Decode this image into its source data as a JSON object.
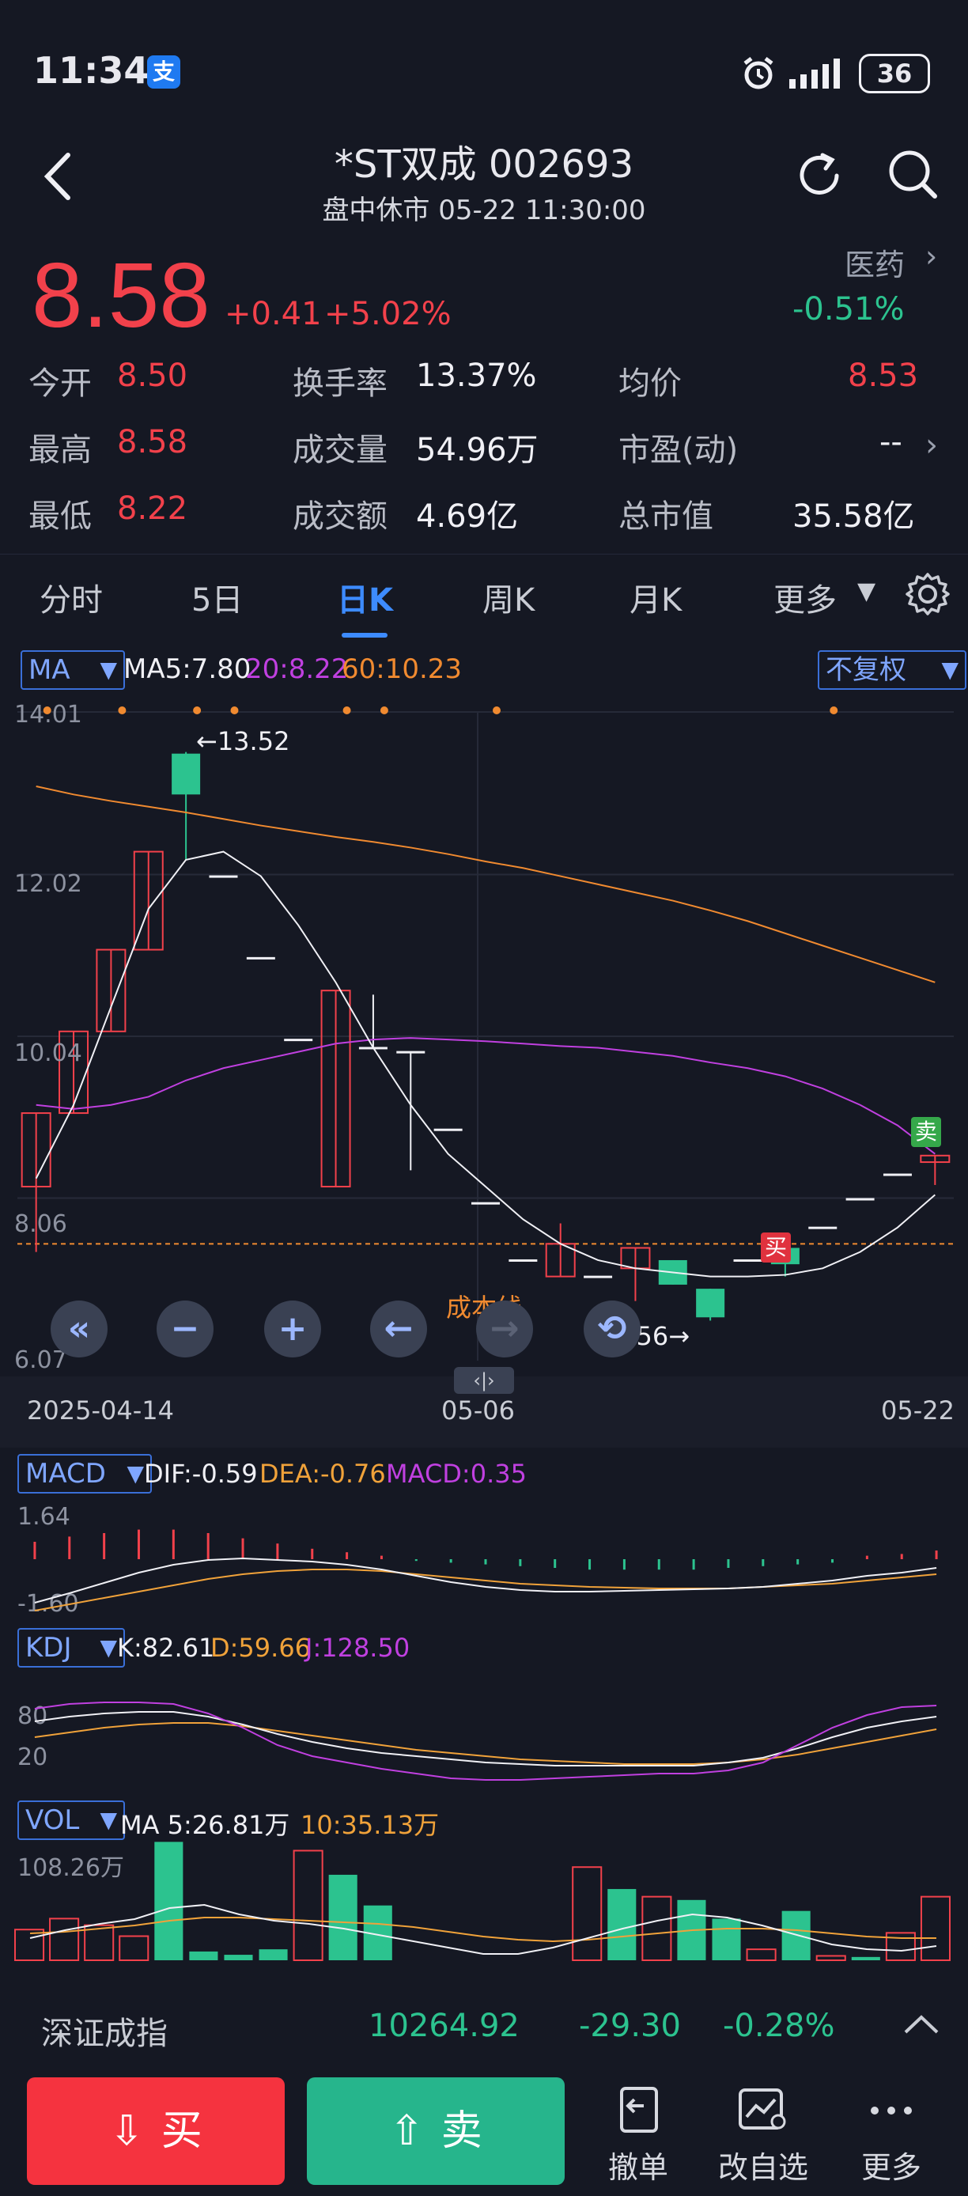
{
  "status_bar": {
    "time": "11:34",
    "app_badge": "支",
    "battery": "36"
  },
  "header": {
    "title": "*ST双成 002693",
    "subtitle": "盘中休市 05-22 11:30:00"
  },
  "quote": {
    "price": "8.58",
    "change_abs": "+0.41",
    "change_pct": "+5.02%",
    "sector": "医药",
    "sector_change": "-0.51%"
  },
  "stats": {
    "open_label": "今开",
    "open": "8.50",
    "high_label": "最高",
    "high": "8.58",
    "low_label": "最低",
    "low": "8.22",
    "turnover_label": "换手率",
    "turnover": "13.37%",
    "volume_label": "成交量",
    "volume": "54.96万",
    "amount_label": "成交额",
    "amount": "4.69亿",
    "avg_label": "均价",
    "avg": "8.53",
    "pe_label": "市盈(动)",
    "pe": "--",
    "mktcap_label": "总市值",
    "mktcap": "35.58亿"
  },
  "tabs": [
    "分时",
    "5日",
    "日K",
    "周K",
    "月K",
    "更多"
  ],
  "ma_bar": {
    "chip": "MA",
    "ma5": "MA5:7.80",
    "ma20": "20:8.22",
    "ma60": "60:10.23",
    "adjust": "不复权"
  },
  "price_axis": [
    "14.01",
    "12.02",
    "10.04",
    "8.06",
    "6.07"
  ],
  "annotations": {
    "high_marker": "←13.52",
    "low_marker": "6.56→",
    "cost_line": "成本线",
    "buy_tag": "买",
    "sell_tag": "卖"
  },
  "dates": {
    "start": "2025-04-14",
    "mid": "05-06",
    "end": "05-22",
    "scroll": "‹|›"
  },
  "macd": {
    "chip": "MACD",
    "dif": "DIF:-0.59",
    "dea": "DEA:-0.76",
    "macd": "MACD:0.35",
    "top": "1.64",
    "bottom": "-1.60"
  },
  "kdj": {
    "chip": "KDJ",
    "k": "K:82.61",
    "d": "D:59.66",
    "j": "J:128.50",
    "l80": "80",
    "l20": "20"
  },
  "vol": {
    "chip": "VOL",
    "ma5": "MA 5:26.81万",
    "ma10": "10:35.13万",
    "top": "108.26万"
  },
  "index": {
    "name": "深证成指",
    "value": "10264.92",
    "change": "-29.30",
    "pct": "-0.28%"
  },
  "actions": {
    "buy": "买",
    "sell": "卖",
    "cancel": "撤单",
    "edit_watch": "改自选",
    "more": "更多"
  },
  "colors": {
    "up": "#f2414b",
    "down": "#2cc38f",
    "accent": "#3d8bff",
    "ma20": "#c040e0",
    "ma60": "#f08a30"
  },
  "chart_data": {
    "type": "candlestick",
    "x_range": [
      "2025-04-14",
      "05-22"
    ],
    "ylim": [
      6.07,
      14.01
    ],
    "candles": [
      {
        "o": 8.2,
        "c": 9.1,
        "h": 9.1,
        "l": 7.4,
        "up": true
      },
      {
        "o": 9.1,
        "c": 10.1,
        "h": 10.1,
        "l": 9.1,
        "up": true
      },
      {
        "o": 10.1,
        "c": 11.1,
        "h": 11.1,
        "l": 10.1,
        "up": true
      },
      {
        "o": 11.1,
        "c": 12.3,
        "h": 12.3,
        "l": 11.1,
        "up": true
      },
      {
        "o": 13.5,
        "c": 13.0,
        "h": 13.52,
        "l": 12.2,
        "up": false
      },
      {
        "o": 12.0,
        "c": 12.0,
        "h": 12.0,
        "l": 12.0,
        "up": false
      },
      {
        "o": 11.0,
        "c": 11.0,
        "h": 11.0,
        "l": 11.0,
        "up": false
      },
      {
        "o": 10.0,
        "c": 10.0,
        "h": 10.0,
        "l": 10.0,
        "up": false
      },
      {
        "o": 8.2,
        "c": 10.6,
        "h": 10.6,
        "l": 8.2,
        "up": true
      },
      {
        "o": 9.9,
        "c": 9.9,
        "h": 10.55,
        "l": 9.9,
        "up": false
      },
      {
        "o": 9.85,
        "c": 9.85,
        "h": 9.85,
        "l": 8.4,
        "up": false
      },
      {
        "o": 8.9,
        "c": 8.9,
        "h": 8.9,
        "l": 8.9,
        "up": false
      },
      {
        "o": 8.0,
        "c": 8.0,
        "h": 8.0,
        "l": 8.0,
        "up": false
      },
      {
        "o": 7.3,
        "c": 7.3,
        "h": 7.3,
        "l": 7.3,
        "up": false
      },
      {
        "o": 7.1,
        "c": 7.5,
        "h": 7.75,
        "l": 7.1,
        "up": true
      },
      {
        "o": 7.1,
        "c": 7.1,
        "h": 7.1,
        "l": 7.1,
        "up": false
      },
      {
        "o": 7.2,
        "c": 7.45,
        "h": 7.45,
        "l": 6.8,
        "up": true
      },
      {
        "o": 7.3,
        "c": 7.0,
        "h": 7.3,
        "l": 7.0,
        "up": false
      },
      {
        "o": 6.95,
        "c": 6.6,
        "h": 6.95,
        "l": 6.56,
        "up": false
      },
      {
        "o": 7.3,
        "c": 7.3,
        "h": 7.3,
        "l": 7.3,
        "up": false
      },
      {
        "o": 7.25,
        "c": 7.45,
        "h": 7.45,
        "l": 7.1,
        "up": false
      },
      {
        "o": 7.7,
        "c": 7.7,
        "h": 7.7,
        "l": 7.7,
        "up": false
      },
      {
        "o": 8.05,
        "c": 8.05,
        "h": 8.05,
        "l": 8.05,
        "up": false
      },
      {
        "o": 8.35,
        "c": 8.35,
        "h": 8.35,
        "l": 8.35,
        "up": false
      },
      {
        "o": 8.5,
        "c": 8.58,
        "h": 8.58,
        "l": 8.22,
        "up": true
      }
    ],
    "ma5": [
      8.3,
      9.2,
      10.4,
      11.6,
      12.2,
      12.3,
      12.0,
      11.4,
      10.7,
      9.9,
      9.2,
      8.6,
      8.2,
      7.8,
      7.5,
      7.3,
      7.2,
      7.15,
      7.1,
      7.1,
      7.12,
      7.2,
      7.4,
      7.7,
      8.1
    ],
    "ma20": [
      9.2,
      9.15,
      9.2,
      9.3,
      9.5,
      9.65,
      9.75,
      9.85,
      9.95,
      10.0,
      10.02,
      10.0,
      9.98,
      9.95,
      9.92,
      9.9,
      9.85,
      9.8,
      9.72,
      9.65,
      9.55,
      9.4,
      9.2,
      8.95,
      8.6
    ],
    "ma60": [
      13.1,
      13.0,
      12.92,
      12.85,
      12.78,
      12.7,
      12.62,
      12.55,
      12.48,
      12.42,
      12.35,
      12.27,
      12.18,
      12.1,
      12.0,
      11.9,
      11.8,
      11.7,
      11.58,
      11.45,
      11.3,
      11.15,
      11.0,
      10.85,
      10.7
    ],
    "volume": [
      28,
      38,
      32,
      22,
      108,
      8,
      5,
      10,
      100,
      78,
      50,
      0,
      0,
      0,
      0,
      0,
      85,
      65,
      58,
      55,
      38,
      10,
      45,
      4,
      3,
      25,
      58
    ]
  }
}
